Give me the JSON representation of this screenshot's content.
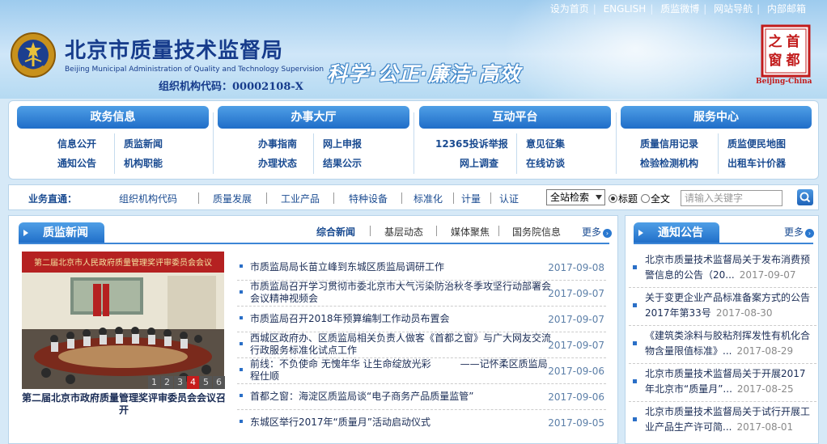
{
  "top_links": [
    "设为首页",
    "ENGLISH",
    "质监微博",
    "网站导航",
    "内部邮箱"
  ],
  "header": {
    "title": "北京市质量技术监督局",
    "title_en": "Beijing Municipal Administration of Quality and Technology Supervision",
    "org_code": "组织机构代码：00002108-X",
    "slogan": "科学·公正·廉洁·高效",
    "logo_chars": [
      "首",
      "都",
      "之",
      "窗"
    ],
    "logo_caption": "Beijing-China"
  },
  "nav": [
    {
      "title": "政务信息",
      "links": [
        "信息公开",
        "质监新闻",
        "通知公告",
        "机构职能"
      ]
    },
    {
      "title": "办事大厅",
      "links": [
        "办事指南",
        "网上申报",
        "办理状态",
        "结果公示"
      ]
    },
    {
      "title": "互动平台",
      "links": [
        "12365投诉举报",
        "意见征集",
        "网上调查",
        "在线访谈"
      ]
    },
    {
      "title": "服务中心",
      "links": [
        "质量信用记录",
        "质监便民地图",
        "检验检测机构",
        "出租车计价器"
      ]
    }
  ],
  "biz": {
    "label": "业务直通：",
    "links": [
      "组织机构代码",
      "质量发展",
      "工业产品",
      "特种设备",
      "标准化",
      "计量",
      "认证"
    ],
    "select": "全站检索",
    "radio_title": "标题",
    "radio_full": "全文",
    "placeholder": "请输入关键字"
  },
  "news": {
    "title": "质监新闻",
    "tabs": [
      "综合新闻",
      "基层动态",
      "媒体聚焦",
      "国务院信息"
    ],
    "more": "更多",
    "photo_banner": "第二届北京市人民政府质量管理奖评审委员会会议",
    "pages": [
      "1",
      "2",
      "3",
      "4",
      "5",
      "6"
    ],
    "caption": "第二届北京市政府质量管理奖评审委员会会议召开",
    "items": [
      {
        "title": "市质监局局长苗立峰到东城区质监局调研工作",
        "date": "2017-09-08"
      },
      {
        "title": "市质监局召开学习贯彻市委北京市大气污染防治秋冬季攻坚行动部署会会议精神视频会",
        "date": "2017-09-07"
      },
      {
        "title": "市质监局召开2018年预算编制工作动员布置会",
        "date": "2017-09-07"
      },
      {
        "title": "西城区政府办、区质监局相关负责人做客《首都之窗》与广大网友交流行政服务标准化试点工作",
        "date": "2017-09-07"
      },
      {
        "title": "前线：不负使命 无愧年华 让生命绽放光彩　　　——记怀柔区质监局程仕顺",
        "date": "2017-09-06"
      },
      {
        "title": "首都之窗：海淀区质监局谈“电子商务产品质量监管”",
        "date": "2017-09-06"
      },
      {
        "title": "东城区举行2017年“质量月”活动启动仪式",
        "date": "2017-09-05"
      }
    ]
  },
  "notice": {
    "title": "通知公告",
    "more": "更多",
    "items": [
      {
        "title": "北京市质量技术监督局关于发布消费预警信息的公告（20...",
        "date": "2017-09-07"
      },
      {
        "title": "关于变更企业产品标准备案方式的公告2017年第33号",
        "date": "2017-08-30"
      },
      {
        "title": "《建筑类涂料与胶粘剂挥发性有机化合物含量限值标准》...",
        "date": "2017-08-29"
      },
      {
        "title": "北京市质量技术监督局关于开展2017年北京市“质量月”...",
        "date": "2017-08-25"
      },
      {
        "title": "北京市质量技术监督局关于试行开展工业产品生产许可简...",
        "date": "2017-08-01"
      }
    ]
  },
  "colors": {
    "accent": "#1f6dc8",
    "link": "#1a4b91",
    "date": "#5c7fa8",
    "active_page": "#c61c1c"
  }
}
